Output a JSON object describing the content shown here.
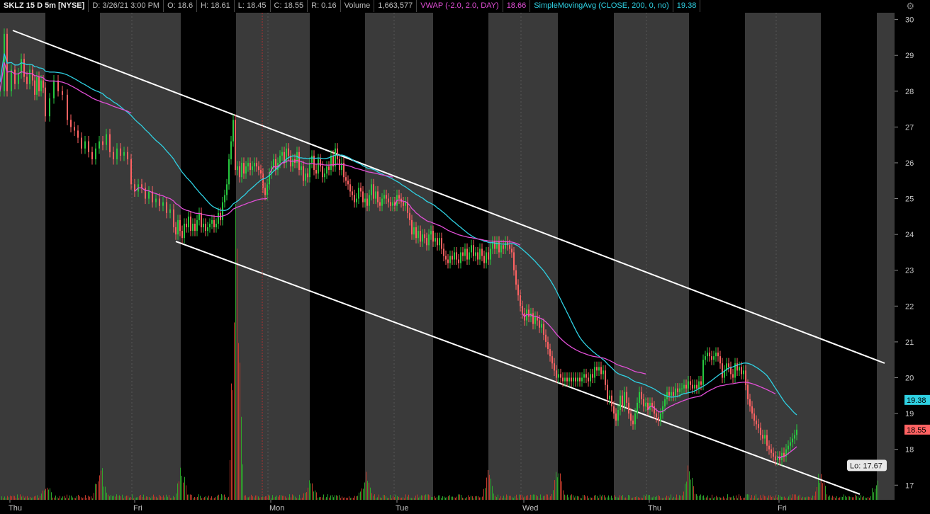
{
  "header": {
    "symbol": "SKLZ 15 D 5m [NYSE]",
    "date": "D: 3/26/21 3:00 PM",
    "open": "O: 18.6",
    "high": "H: 18.61",
    "low": "L: 18.45",
    "close": "C: 18.55",
    "range": "R: 0.16",
    "volume_label": "Volume",
    "volume_value": "1,663,577",
    "vwap_label": "VWAP (-2.0, 2.0, DAY)",
    "vwap_value": "18.66",
    "sma_label": "SimpleMovingAvg (CLOSE, 200, 0, no)",
    "sma_value": "19.38"
  },
  "chart_data": {
    "type": "line",
    "title": "",
    "ylim": [
      16.6,
      30.2
    ],
    "y_ticks": [
      "17",
      "18",
      "19",
      "20",
      "21",
      "22",
      "23",
      "24",
      "25",
      "26",
      "27",
      "28",
      "29",
      "30"
    ],
    "x_day_labels": [
      "Thu",
      "Fri",
      "Mon",
      "Tue",
      "Wed",
      "Thu",
      "Fri"
    ],
    "price_badge": "18.55",
    "sma_badge": "19.38",
    "low_label": "Lo: 17.67",
    "x": [
      0,
      6,
      10,
      16,
      21,
      26,
      30,
      34,
      38,
      42,
      46,
      49,
      52,
      55,
      58,
      61,
      64,
      70,
      76,
      82,
      88,
      95,
      100,
      105,
      110,
      115,
      120,
      125,
      130,
      135,
      140,
      145,
      150,
      155,
      160,
      165,
      170,
      175,
      180,
      185,
      190,
      195,
      200,
      205,
      210,
      215,
      220,
      225,
      230,
      235,
      240,
      245,
      248,
      251,
      254,
      257,
      260,
      263,
      266,
      269,
      272,
      275,
      278,
      281,
      284,
      287,
      290,
      293,
      296,
      299,
      302,
      305,
      308,
      311,
      314,
      317,
      320,
      323,
      326,
      329,
      332,
      335,
      338,
      341,
      344,
      347,
      350,
      353,
      356,
      359,
      362,
      365,
      368,
      371,
      374,
      377,
      380,
      383,
      386,
      389,
      392,
      395,
      398,
      401,
      404,
      407,
      410,
      413,
      416,
      419,
      422,
      425,
      428,
      431,
      434,
      437,
      440,
      443,
      446,
      449,
      452,
      455,
      458,
      461,
      464,
      467,
      470,
      473,
      476,
      479,
      482,
      485,
      488,
      491,
      494,
      497,
      500,
      503,
      506,
      509,
      512,
      515,
      518,
      521,
      524,
      527,
      530,
      533,
      536,
      539,
      542,
      545,
      548,
      551,
      554,
      557,
      560,
      563,
      566,
      569,
      572,
      575,
      578,
      581,
      584,
      587,
      590,
      593,
      596,
      599,
      602,
      605,
      608,
      611,
      614,
      617,
      620,
      623,
      626,
      629,
      632,
      635,
      638,
      641,
      644,
      647,
      650,
      653,
      656,
      659,
      662,
      665,
      668,
      671,
      674,
      677,
      680,
      683,
      686,
      689,
      692,
      695,
      698,
      701,
      704,
      707,
      710,
      713,
      716,
      719,
      722,
      725,
      728,
      731,
      734,
      737,
      740,
      743,
      746,
      749,
      752,
      755,
      758,
      761,
      764,
      767,
      770,
      773,
      776,
      779,
      782,
      785,
      788,
      791,
      794,
      797,
      800,
      803,
      806,
      809,
      812,
      815,
      818,
      821,
      824,
      827,
      830,
      833,
      836,
      839,
      842,
      845,
      848,
      851,
      854,
      857,
      860,
      863,
      866,
      869,
      872,
      875,
      878,
      881,
      884,
      887,
      890,
      893,
      896,
      899,
      902,
      905,
      908,
      911,
      914,
      917,
      920,
      923,
      926,
      929,
      932,
      935,
      938,
      941,
      944,
      947,
      950,
      953,
      956,
      959,
      962,
      965,
      968,
      971,
      974,
      977,
      980,
      983,
      986,
      989,
      992,
      995,
      998,
      1001,
      1004,
      1007,
      1010,
      1013,
      1016,
      1019,
      1022,
      1025,
      1028,
      1031,
      1034,
      1037,
      1040,
      1043,
      1046,
      1049,
      1052,
      1055,
      1058,
      1061,
      1064,
      1067,
      1070,
      1073,
      1076,
      1079,
      1082,
      1085,
      1088,
      1091,
      1094,
      1097,
      1100,
      1103,
      1106,
      1109,
      1112,
      1115,
      1118,
      1121,
      1124,
      1127,
      1130,
      1133,
      1136,
      1139,
      1142,
      1145,
      1148,
      1151,
      1154,
      1157,
      1160,
      1163,
      1166,
      1169,
      1172,
      1175,
      1178,
      1181,
      1184,
      1187,
      1190,
      1193,
      1196,
      1199,
      1202,
      1205,
      1208,
      1211,
      1214,
      1217,
      1220,
      1223,
      1226,
      1229,
      1232,
      1235,
      1237
    ],
    "series": [
      {
        "values": [
          28.0,
          29.6,
          28.0,
          28.6,
          28.2,
          28.5,
          28.9,
          28.4,
          28.2,
          28.6,
          28.3,
          27.9,
          28.4,
          28.0,
          28.3,
          28.1,
          27.3,
          27.8,
          28.3,
          28.0,
          27.9,
          27.2,
          27.0,
          26.9,
          26.7,
          26.4,
          26.6,
          26.3,
          26.1,
          26.4,
          26.6,
          26.5,
          26.8,
          26.3,
          26.1,
          26.4,
          26.2,
          26.3,
          26.1,
          25.4,
          25.2,
          25.4,
          25.3,
          25.0,
          25.2,
          24.9,
          25.0,
          24.8,
          24.9,
          24.6,
          24.7,
          24.2,
          24.0,
          24.4,
          24.1,
          23.9,
          24.3,
          24.2,
          24.5,
          24.1,
          24.3,
          24.1,
          24.4,
          24.6,
          24.2,
          24.3,
          24.1,
          24.2,
          24.3,
          24.4,
          24.2,
          24.3,
          24.6,
          24.4,
          24.9,
          25.1,
          25.4,
          26.1,
          26.6,
          27.2,
          25.8,
          25.9,
          25.6,
          26.0,
          25.7,
          25.9,
          26.0,
          25.8,
          25.9,
          26.0,
          25.9,
          25.8,
          25.7,
          25.3,
          25.1,
          25.4,
          25.7,
          25.9,
          26.1,
          25.8,
          26.0,
          26.2,
          26.3,
          26.0,
          26.4,
          26.2,
          25.9,
          26.1,
          26.0,
          26.3,
          25.8,
          25.9,
          25.5,
          25.7,
          25.6,
          26.0,
          26.2,
          25.8,
          25.7,
          26.1,
          25.9,
          25.6,
          25.7,
          25.9,
          25.8,
          26.2,
          25.9,
          26.4,
          26.1,
          25.8,
          26.0,
          25.6,
          25.5,
          25.4,
          25.2,
          25.1,
          24.9,
          25.0,
          25.3,
          25.2,
          24.9,
          25.0,
          24.8,
          25.1,
          25.4,
          25.0,
          25.2,
          24.9,
          24.8,
          25.0,
          25.1,
          25.0,
          24.9,
          24.8,
          24.9,
          24.8,
          25.1,
          25.0,
          24.9,
          24.8,
          24.9,
          24.6,
          24.4,
          24.0,
          24.2,
          23.9,
          24.1,
          23.8,
          24.0,
          23.9,
          23.7,
          24.0,
          24.1,
          23.8,
          23.9,
          23.7,
          23.9,
          23.6,
          23.4,
          23.3,
          23.2,
          23.4,
          23.3,
          23.5,
          23.3,
          23.2,
          23.5,
          23.4,
          23.6,
          23.3,
          23.5,
          23.7,
          23.4,
          23.5,
          23.3,
          23.6,
          23.4,
          23.2,
          23.5,
          23.3,
          23.6,
          23.8,
          23.6,
          23.8,
          23.5,
          23.7,
          23.6,
          23.8,
          23.7,
          23.6,
          23.5,
          23.0,
          22.6,
          22.3,
          22.0,
          21.8,
          21.6,
          21.9,
          21.7,
          21.8,
          21.5,
          21.7,
          21.6,
          21.4,
          21.5,
          21.2,
          21.0,
          20.8,
          20.6,
          20.4,
          20.2,
          20.0,
          20.1,
          20.0,
          19.9,
          20.0,
          19.9,
          20.0,
          19.9,
          20.0,
          19.9,
          20.0,
          19.9,
          20.0,
          20.1,
          20.0,
          19.9,
          20.1,
          20.0,
          20.3,
          20.2,
          20.3,
          20.1,
          20.2,
          19.8,
          19.4,
          19.5,
          19.2,
          19.0,
          18.8,
          19.1,
          19.5,
          19.2,
          19.6,
          19.3,
          19.0,
          18.8,
          18.7,
          19.0,
          19.3,
          19.6,
          19.4,
          19.2,
          19.3,
          19.1,
          19.3,
          19.2,
          19.0,
          18.9,
          18.8,
          19.0,
          19.2,
          19.4,
          19.6,
          19.5,
          19.6,
          19.5,
          19.7,
          19.6,
          19.7,
          19.7,
          19.8,
          19.7,
          19.9,
          19.8,
          19.7,
          19.8,
          19.7,
          19.9,
          19.8,
          20.5,
          20.6,
          20.7,
          20.6,
          20.5,
          20.6,
          20.7,
          20.6,
          20.4,
          20.0,
          20.2,
          20.4,
          20.3,
          20.1,
          20.0,
          20.4,
          20.2,
          20.3,
          20.1,
          20.2,
          19.8,
          19.4,
          19.2,
          19.0,
          18.8,
          18.7,
          18.6,
          18.4,
          18.3,
          18.4,
          18.1,
          18.0,
          17.9,
          17.8,
          17.7,
          17.8,
          17.7,
          17.9,
          17.8,
          18.0,
          18.1,
          18.2,
          18.3,
          18.4,
          18.55
        ]
      }
    ]
  }
}
